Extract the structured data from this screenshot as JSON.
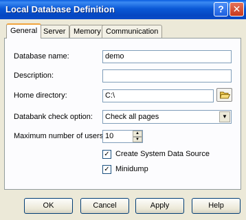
{
  "window": {
    "title": "Local Database Definition",
    "help_glyph": "?",
    "close_glyph": "✕"
  },
  "tabs": [
    {
      "label": "General"
    },
    {
      "label": "Server"
    },
    {
      "label": "Memory"
    },
    {
      "label": "Communication"
    }
  ],
  "form": {
    "database_name": {
      "label": "Database name:",
      "value": "demo"
    },
    "description": {
      "label": "Description:",
      "value": ""
    },
    "home_directory": {
      "label": "Home directory:",
      "value": "C:\\"
    },
    "databank_check": {
      "label": "Databank check option:",
      "value": "Check all pages",
      "arrow": "▼"
    },
    "max_users": {
      "label": "Maximum number of users:",
      "value": "10",
      "up": "▲",
      "down": "▼"
    },
    "create_system_data_source": {
      "label": "Create System Data Source",
      "checked": true,
      "mark": "✓"
    },
    "minidump": {
      "label": "Minidump",
      "checked": true,
      "mark": "✓"
    }
  },
  "buttons": {
    "ok": "OK",
    "cancel": "Cancel",
    "apply": "Apply",
    "help": "Help"
  },
  "colors": {
    "title_bar": "#0a58d6",
    "active_tab_accent": "#f1a33b",
    "dialog_bg": "#ece9d8"
  }
}
